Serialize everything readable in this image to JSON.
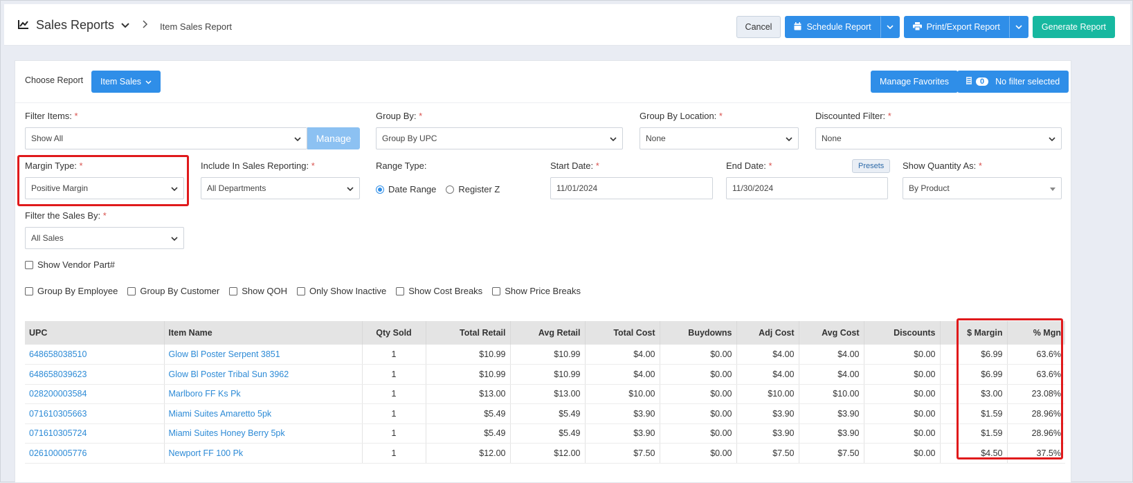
{
  "header": {
    "app_title": "Sales Reports",
    "breadcrumb": "Item Sales Report",
    "cancel_label": "Cancel",
    "schedule_label": "Schedule Report",
    "print_label": "Print/Export Report",
    "generate_label": "Generate Report"
  },
  "toolbar": {
    "choose_report_label": "Choose Report",
    "report_selected": "Item Sales",
    "manage_favorites_label": "Manage Favorites",
    "filter_count": "0",
    "filter_label": "No filter selected"
  },
  "filters": {
    "filter_items_label": "Filter Items:",
    "filter_items_value": "Show All",
    "manage_label": "Manage",
    "group_by_label": "Group By:",
    "group_by_value": "Group By UPC",
    "group_by_location_label": "Group By Location:",
    "group_by_location_value": "None",
    "discounted_filter_label": "Discounted Filter:",
    "discounted_filter_value": "None",
    "margin_type_label": "Margin Type:",
    "margin_type_value": "Positive Margin",
    "include_label": "Include In Sales Reporting:",
    "include_value": "All Departments",
    "range_type_label": "Range Type:",
    "range_date": "Date Range",
    "range_register": "Register Z",
    "start_date_label": "Start Date:",
    "start_date_value": "11/01/2024",
    "end_date_label": "End Date:",
    "end_date_value": "11/30/2024",
    "presets_label": "Presets",
    "show_qty_label": "Show Quantity As:",
    "show_qty_value": "By Product",
    "filter_sales_label": "Filter the Sales By:",
    "filter_sales_value": "All Sales",
    "required_mark": "*"
  },
  "checkboxes": {
    "vendor_part": "Show Vendor Part#",
    "group_employee": "Group By Employee",
    "group_customer": "Group By Customer",
    "show_qoh": "Show QOH",
    "only_inactive": "Only Show Inactive",
    "cost_breaks": "Show Cost Breaks",
    "price_breaks": "Show Price Breaks"
  },
  "table": {
    "columns": [
      "UPC",
      "Item Name",
      "Qty Sold",
      "Total Retail",
      "Avg Retail",
      "Total Cost",
      "Buydowns",
      "Adj Cost",
      "Avg Cost",
      "Discounts",
      "$ Margin",
      "% Mgn"
    ],
    "rows": [
      [
        "648658038510",
        "Glow Bl Poster Serpent 3851",
        "1",
        "$10.99",
        "$10.99",
        "$4.00",
        "$0.00",
        "$4.00",
        "$4.00",
        "$0.00",
        "$6.99",
        "63.6%"
      ],
      [
        "648658039623",
        "Glow Bl Poster Tribal Sun 3962",
        "1",
        "$10.99",
        "$10.99",
        "$4.00",
        "$0.00",
        "$4.00",
        "$4.00",
        "$0.00",
        "$6.99",
        "63.6%"
      ],
      [
        "028200003584",
        "Marlboro FF Ks Pk",
        "1",
        "$13.00",
        "$13.00",
        "$10.00",
        "$0.00",
        "$10.00",
        "$10.00",
        "$0.00",
        "$3.00",
        "23.08%"
      ],
      [
        "071610305663",
        "Miami Suites Amaretto 5pk",
        "1",
        "$5.49",
        "$5.49",
        "$3.90",
        "$0.00",
        "$3.90",
        "$3.90",
        "$0.00",
        "$1.59",
        "28.96%"
      ],
      [
        "071610305724",
        "Miami Suites Honey Berry 5pk",
        "1",
        "$5.49",
        "$5.49",
        "$3.90",
        "$0.00",
        "$3.90",
        "$3.90",
        "$0.00",
        "$1.59",
        "28.96%"
      ],
      [
        "026100005776",
        "Newport FF 100 Pk",
        "1",
        "$12.00",
        "$12.00",
        "$7.50",
        "$0.00",
        "$7.50",
        "$7.50",
        "$0.00",
        "$4.50",
        "37.5%"
      ]
    ]
  },
  "colors": {
    "primary": "#2f8ee8",
    "teal": "#17b8a0",
    "highlight": "#e0191b",
    "link": "#2c8ad6"
  }
}
